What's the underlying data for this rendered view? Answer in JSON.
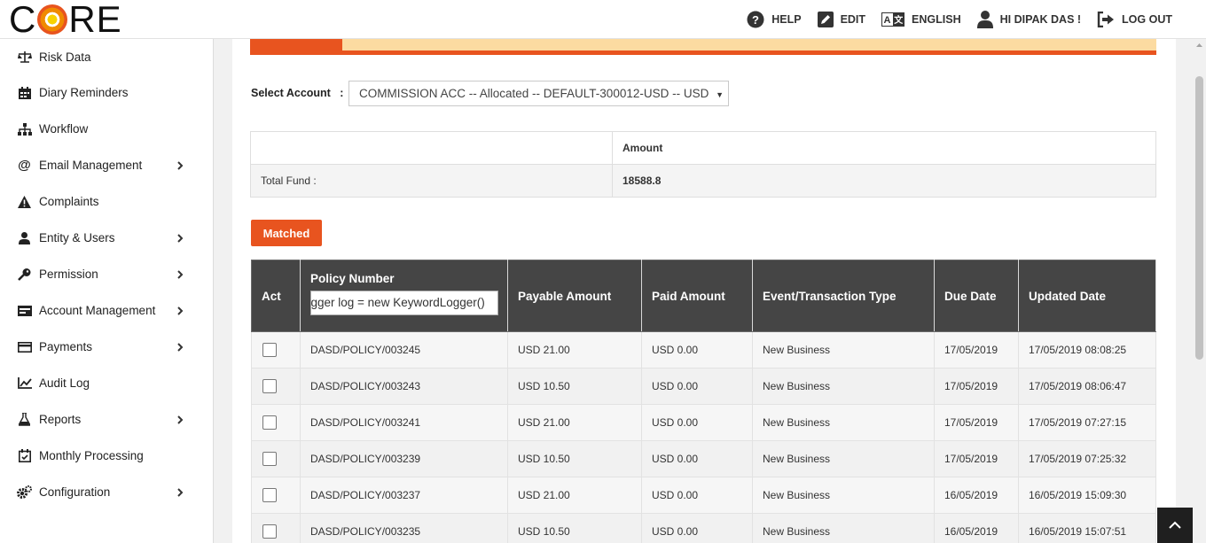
{
  "brand": {
    "logo_text_left": "C",
    "logo_text_right": "RE"
  },
  "topnav": [
    {
      "key": "help",
      "label": "HELP",
      "icon": "help-circle-icon"
    },
    {
      "key": "edit",
      "label": "EDIT",
      "icon": "edit-icon"
    },
    {
      "key": "language",
      "label": "ENGLISH",
      "icon": "translate-icon"
    },
    {
      "key": "user",
      "label": "HI DIPAK DAS !",
      "icon": "user-icon"
    },
    {
      "key": "logout",
      "label": "LOG OUT",
      "icon": "logout-icon"
    }
  ],
  "sidebar": {
    "items": [
      {
        "label": "Risk Data",
        "icon": "scale-icon",
        "has_children": false
      },
      {
        "label": "Diary Reminders",
        "icon": "calendar-icon",
        "has_children": false
      },
      {
        "label": "Workflow",
        "icon": "sitemap-icon",
        "has_children": false
      },
      {
        "label": "Email Management",
        "icon": "at-icon",
        "has_children": true
      },
      {
        "label": "Complaints",
        "icon": "warning-icon",
        "has_children": false
      },
      {
        "label": "Entity & Users",
        "icon": "user-icon",
        "has_children": true
      },
      {
        "label": "Permission",
        "icon": "key-icon",
        "has_children": true
      },
      {
        "label": "Account Management",
        "icon": "account-icon",
        "has_children": true
      },
      {
        "label": "Payments",
        "icon": "credit-card-icon",
        "has_children": true
      },
      {
        "label": "Audit Log",
        "icon": "line-chart-icon",
        "has_children": false
      },
      {
        "label": "Reports",
        "icon": "flask-icon",
        "has_children": true
      },
      {
        "label": "Monthly Processing",
        "icon": "calendar-check-icon",
        "has_children": false
      },
      {
        "label": "Configuration",
        "icon": "cogs-icon",
        "has_children": true
      }
    ]
  },
  "account": {
    "label": "Select Account",
    "separator": ":",
    "selected": "COMMISSION ACC -- Allocated -- DEFAULT-300012-USD -- USD"
  },
  "fund": {
    "header_amount": "Amount",
    "row_label": "Total Fund :",
    "row_value": "18588.8"
  },
  "matched_button": "Matched",
  "grid": {
    "columns": {
      "act": "Act",
      "policy": "Policy Number",
      "payable": "Payable Amount",
      "paid": "Paid Amount",
      "event": "Event/Transaction Type",
      "due": "Due Date",
      "updated": "Updated Date"
    },
    "policy_filter_value": "ogger log = new KeywordLogger()",
    "rows": [
      {
        "policy": "DASD/POLICY/003245",
        "payable": "USD 21.00",
        "paid": "USD 0.00",
        "event": "New Business",
        "due": "17/05/2019",
        "updated": "17/05/2019 08:08:25"
      },
      {
        "policy": "DASD/POLICY/003243",
        "payable": "USD 10.50",
        "paid": "USD 0.00",
        "event": "New Business",
        "due": "17/05/2019",
        "updated": "17/05/2019 08:06:47"
      },
      {
        "policy": "DASD/POLICY/003241",
        "payable": "USD 21.00",
        "paid": "USD 0.00",
        "event": "New Business",
        "due": "17/05/2019",
        "updated": "17/05/2019 07:27:15"
      },
      {
        "policy": "DASD/POLICY/003239",
        "payable": "USD 10.50",
        "paid": "USD 0.00",
        "event": "New Business",
        "due": "17/05/2019",
        "updated": "17/05/2019 07:25:32"
      },
      {
        "policy": "DASD/POLICY/003237",
        "payable": "USD 21.00",
        "paid": "USD 0.00",
        "event": "New Business",
        "due": "16/05/2019",
        "updated": "16/05/2019 15:09:30"
      },
      {
        "policy": "DASD/POLICY/003235",
        "payable": "USD 10.50",
        "paid": "USD 0.00",
        "event": "New Business",
        "due": "16/05/2019",
        "updated": "16/05/2019 15:07:51"
      }
    ]
  },
  "colors": {
    "accent": "#e8541f",
    "banner": "#fcdba1",
    "table_header": "#454545"
  }
}
